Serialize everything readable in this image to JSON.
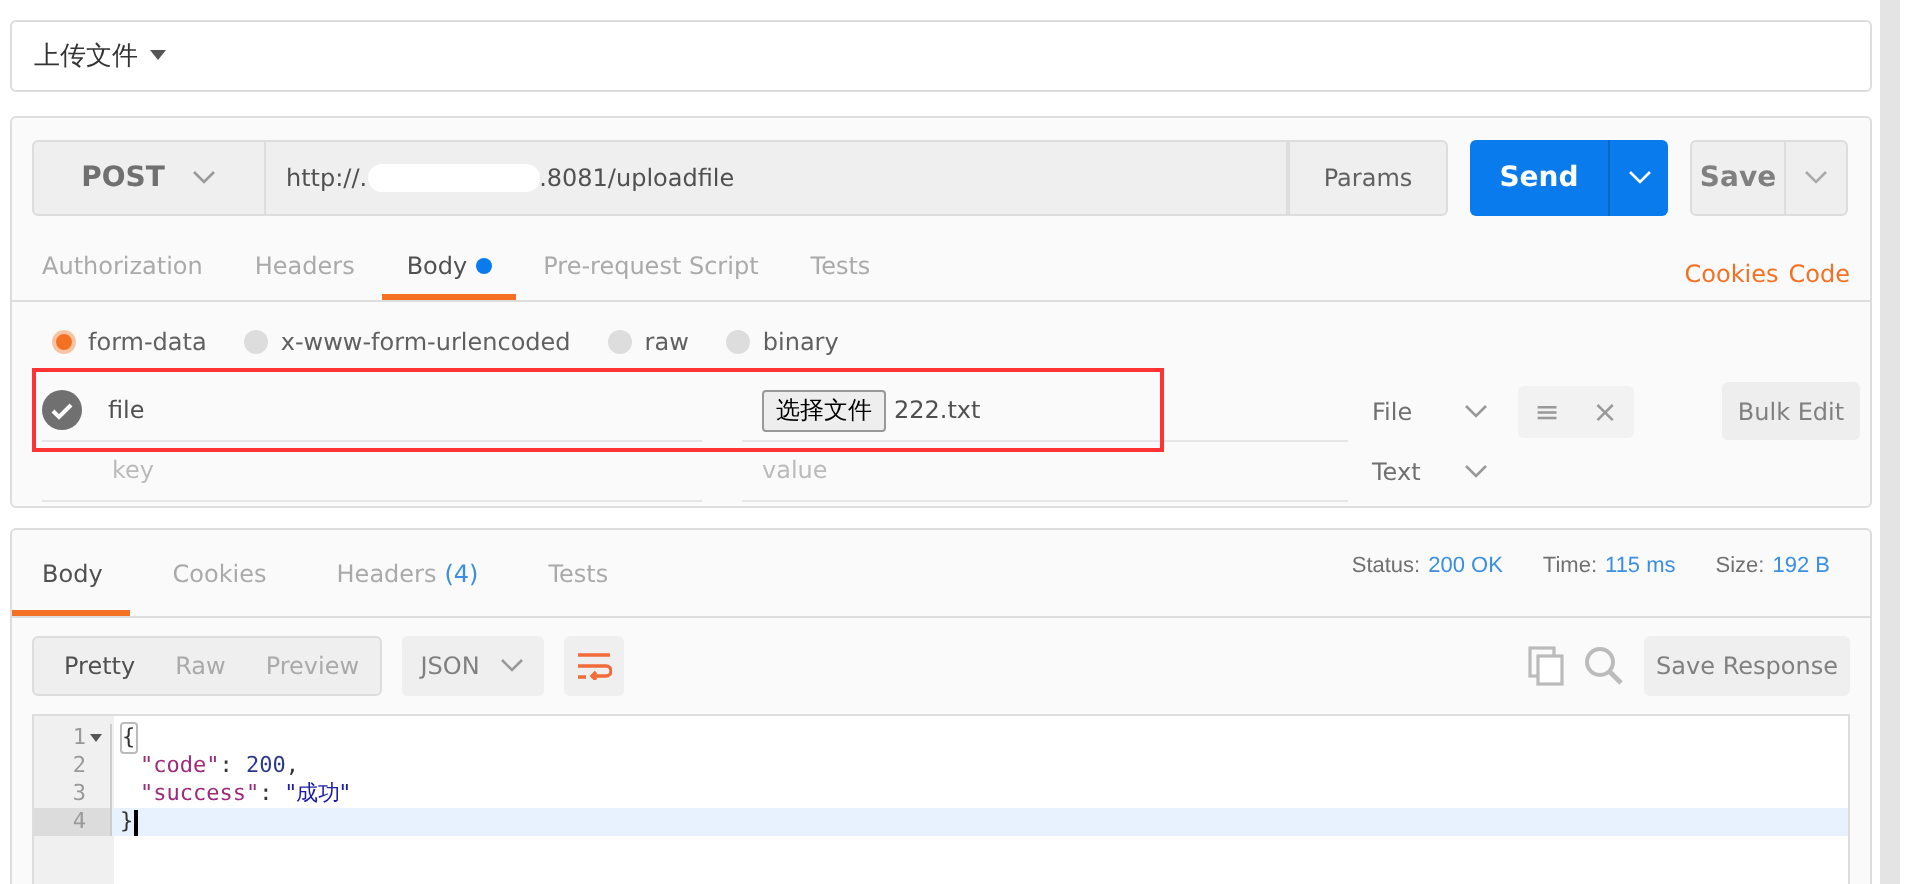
{
  "collection_title": "上传文件",
  "request": {
    "method": "POST",
    "url_parts": [
      "http://.",
      ".8081/uploadfile"
    ],
    "params_label": "Params",
    "send_label": "Send",
    "save_label": "Save",
    "tabs": [
      {
        "label": "Authorization",
        "selected": false,
        "dot": false
      },
      {
        "label": "Headers",
        "selected": false,
        "dot": false
      },
      {
        "label": "Body",
        "selected": true,
        "dot": true
      },
      {
        "label": "Pre-request Script",
        "selected": false,
        "dot": false
      },
      {
        "label": "Tests",
        "selected": false,
        "dot": false
      }
    ],
    "links": [
      "Cookies",
      "Code"
    ],
    "body_modes": [
      {
        "label": "form-data",
        "selected": true
      },
      {
        "label": "x-www-form-urlencoded",
        "selected": false
      },
      {
        "label": "raw",
        "selected": false
      },
      {
        "label": "binary",
        "selected": false
      }
    ],
    "form_rows": [
      {
        "checked": true,
        "key": "file",
        "kind": "file",
        "file_button": "选择文件",
        "file_name": "222.txt",
        "type": "File",
        "highlighted": true
      },
      {
        "kind": "empty",
        "key_placeholder": "key",
        "value_placeholder": "value",
        "type": "Text"
      }
    ],
    "row_actions": [
      "≡",
      "×"
    ],
    "bulk_edit": "Bulk Edit"
  },
  "response": {
    "tabs": [
      {
        "label": "Body",
        "selected": true
      },
      {
        "label": "Cookies",
        "selected": false
      },
      {
        "label": "Headers",
        "count": "(4)",
        "selected": false
      },
      {
        "label": "Tests",
        "selected": false
      }
    ],
    "stats": [
      {
        "label": "Status:",
        "value": "200 OK"
      },
      {
        "label": "Time:",
        "value": "115 ms"
      },
      {
        "label": "Size:",
        "value": "192 B"
      }
    ],
    "views": [
      {
        "label": "Pretty",
        "selected": true
      },
      {
        "label": "Raw",
        "selected": false
      },
      {
        "label": "Preview",
        "selected": false
      }
    ],
    "format": "JSON",
    "save_response": "Save Response",
    "code_lines": [
      {
        "number": "1",
        "foldable": true,
        "current": false,
        "tokens": [
          {
            "kind": "bracket",
            "text": "{"
          }
        ]
      },
      {
        "number": "2",
        "foldable": false,
        "current": false,
        "tokens": [
          {
            "kind": "key",
            "text": "\"code\""
          },
          {
            "kind": "punct",
            "text": ": "
          },
          {
            "kind": "number",
            "text": "200"
          },
          {
            "kind": "punct",
            "text": ","
          }
        ]
      },
      {
        "number": "3",
        "foldable": false,
        "current": false,
        "tokens": [
          {
            "kind": "key",
            "text": "\"success\""
          },
          {
            "kind": "punct",
            "text": ": "
          },
          {
            "kind": "string",
            "text": "\"成功\""
          }
        ]
      },
      {
        "number": "4",
        "foldable": false,
        "current": true,
        "tokens": [
          {
            "kind": "punct",
            "text": "}"
          }
        ]
      }
    ]
  }
}
